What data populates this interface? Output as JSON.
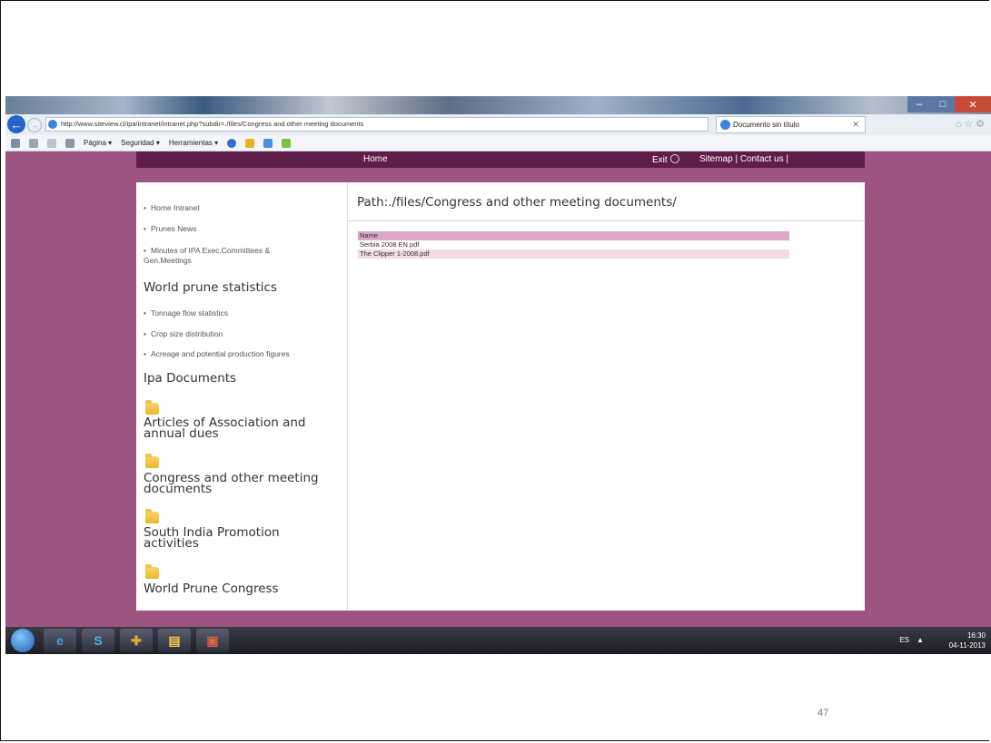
{
  "slide": {
    "number": "47"
  },
  "browser": {
    "url": "http://www.siteview.cl/ipa/intranet/intranet.php?subdir=./files/Congress and other meeting documents",
    "tab_title": "Documento sin título",
    "commands": [
      "Página ▾",
      "Seguridad ▾",
      "Herramientas ▾"
    ]
  },
  "site": {
    "nav": {
      "home": "Home",
      "exit": "Exit",
      "links": "Sitemap | Contact us |"
    },
    "sidebar": {
      "links": [
        "Home Intranet",
        "Prunes News",
        "Minutes of IPA Exec.Committees &",
        "Gen.Meetings"
      ],
      "stats_heading": "World prune statistics",
      "stats_links": [
        "Tonnage flow statistics",
        "Crop size distribution",
        "Acreage and potential production figures"
      ],
      "docs_heading": "Ipa Documents",
      "folders": [
        [
          "Articles of Association and",
          "annual dues"
        ],
        [
          "Congress and other meeting",
          "documents"
        ],
        [
          "South India Promotion",
          "activities"
        ],
        [
          "World Prune Congress",
          ""
        ]
      ]
    },
    "main": {
      "path": "Path:./files/Congress and other meeting documents/",
      "table_header": "Name",
      "files": [
        "Serbia 2008 EN.pdf",
        "The Clipper 1-2008.pdf"
      ]
    }
  },
  "taskbar": {
    "lang": "ES",
    "time": "16:30",
    "date": "04-11-2013"
  },
  "colors": {
    "page_bg": "#9c5580",
    "nav_bg": "#5e1e47",
    "table_header": "#dba8c8",
    "row_alt": "#f0dbe7"
  }
}
